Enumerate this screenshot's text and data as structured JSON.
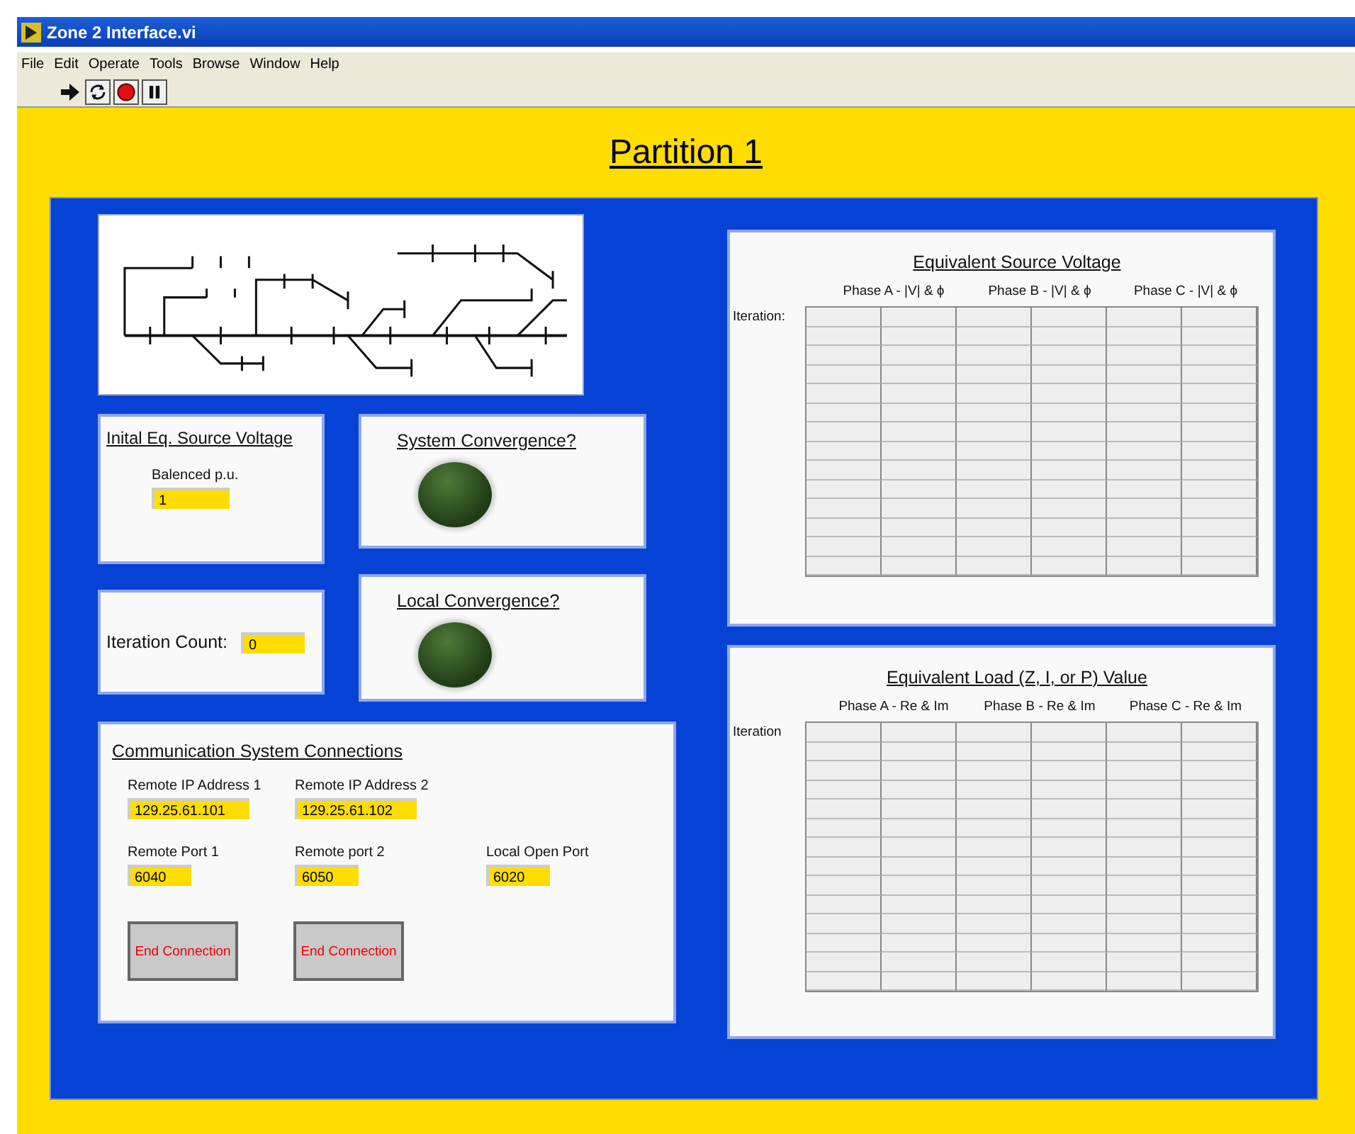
{
  "window": {
    "title": "Zone 2 Interface.vi"
  },
  "menu": [
    "File",
    "Edit",
    "Operate",
    "Tools",
    "Browse",
    "Window",
    "Help"
  ],
  "toolbar": [
    {
      "kind": "run"
    },
    {
      "kind": "run-continuous"
    },
    {
      "kind": "abort"
    },
    {
      "kind": "pause"
    }
  ],
  "heading": "Partition 1",
  "initial_voltage": {
    "title": "Inital Eq. Source Voltage",
    "field_label": "Balenced p.u.",
    "value": "1"
  },
  "iteration_count": {
    "label": "Iteration Count:",
    "value": "0"
  },
  "system_convergence": {
    "title": "System Convergence?",
    "on": false
  },
  "local_convergence": {
    "title": "Local Convergence?",
    "on": false
  },
  "communication": {
    "title": "Communication System Connections",
    "field_rows": [
      [
        {
          "label": "Remote IP Address 1",
          "value": "129.25.61.101"
        },
        {
          "label": "Remote IP Address 2",
          "value": "129.25.61.102"
        }
      ],
      [
        {
          "label": "Remote Port 1",
          "value": "6040"
        },
        {
          "label": "Remote port 2",
          "value": "6050"
        },
        {
          "label": "Local Open Port",
          "value": "6020"
        }
      ]
    ],
    "buttons": [
      "End Connection",
      "End Connection"
    ]
  },
  "tables": [
    {
      "title": "Equivalent Source Voltage",
      "row_label": "Iteration:",
      "columns": [
        "Phase A - |V| & ϕ",
        "Phase B - |V| & ϕ",
        "Phase C - |V| & ϕ"
      ]
    },
    {
      "title": "Equivalent Load (Z, I, or P) Value",
      "row_label": "Iteration",
      "columns": [
        "Phase A - Re & Im",
        "Phase B - Re & Im",
        "Phase C - Re & Im"
      ]
    }
  ]
}
